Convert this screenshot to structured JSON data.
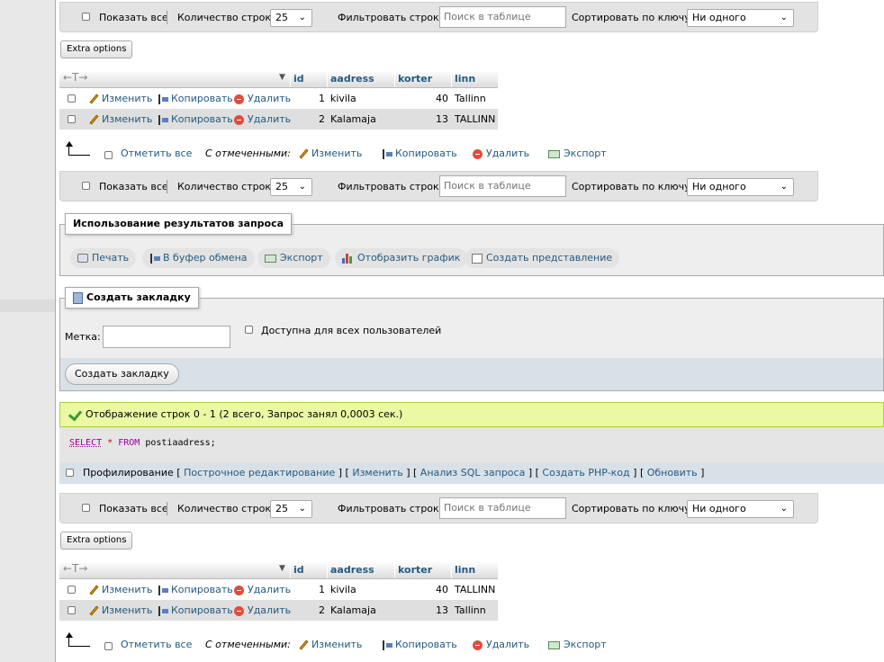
{
  "nav": {
    "show_all": "Показать все",
    "rows_count_label": "Количество строк:",
    "rows_count_value": "25",
    "filter_label": "Фильтровать строки:",
    "filter_placeholder": "Поиск в таблице",
    "sort_label": "Сортировать по ключу:",
    "sort_value": "Ни одного"
  },
  "extra_options": "Extra options",
  "table": {
    "arrows": "←T→",
    "columns": [
      "id",
      "aadress",
      "korter",
      "linn"
    ],
    "actions": {
      "edit": "Изменить",
      "copy": "Копировать",
      "delete": "Удалить"
    }
  },
  "results_top": [
    {
      "id": "1",
      "aadress": "kivila",
      "korter": "40",
      "linn": "Tallinn"
    },
    {
      "id": "2",
      "aadress": "Kalamaja",
      "korter": "13",
      "linn": "TALLINN"
    }
  ],
  "results_bottom": [
    {
      "id": "1",
      "aadress": "kivila",
      "korter": "40",
      "linn": "TALLINN"
    },
    {
      "id": "2",
      "aadress": "Kalamaja",
      "korter": "13",
      "linn": "Tallinn"
    }
  ],
  "bulk": {
    "check_all": "Отметить все",
    "with_selected": "С отмеченными:",
    "edit": "Изменить",
    "copy": "Копировать",
    "delete": "Удалить",
    "export": "Экспорт"
  },
  "query_results": {
    "legend": "Использование результатов запроса",
    "print": "Печать",
    "clipboard": "В буфер обмена",
    "export": "Экспорт",
    "chart": "Отобразить график",
    "create_view": "Создать представление"
  },
  "bookmark": {
    "legend": "Создать закладку",
    "label": "Метка:",
    "public_label": "Доступна для всех пользователей",
    "submit": "Создать закладку"
  },
  "success_message": "Отображение строк 0 - 1 (2 всего, Запрос занял 0,0003 сек.)",
  "sql": {
    "select": "SELECT",
    "star": "*",
    "from": "FROM",
    "table": "postiaadress;"
  },
  "tools": {
    "profiling": "Профилирование",
    "inline_edit": "Построчное редактирование",
    "edit": "Изменить",
    "analyze": "Анализ SQL запроса",
    "php_code": "Создать PHP-код",
    "refresh": "Обновить"
  },
  "colors": {
    "link": "#235a81",
    "success_bg": "#ebf8a4",
    "success_border": "#a2d246"
  }
}
